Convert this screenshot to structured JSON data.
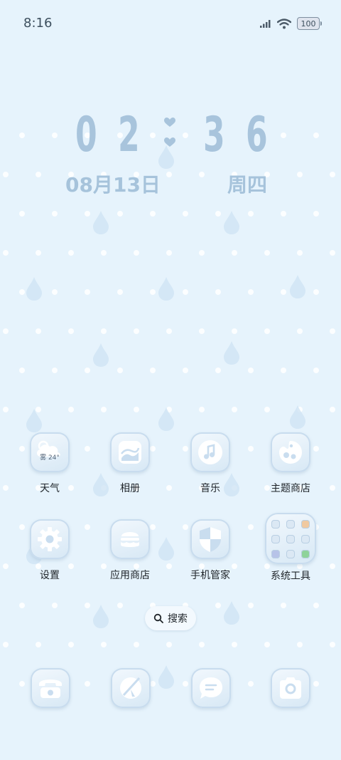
{
  "status_bar": {
    "time": "8:16",
    "battery": "100"
  },
  "clock": {
    "h1": "0",
    "h2": "2",
    "m1": "3",
    "m2": "6",
    "date": "08月13日",
    "weekday": "周四"
  },
  "apps_row1": [
    {
      "label": "天气",
      "weather_badge": "雾 24°"
    },
    {
      "label": "相册"
    },
    {
      "label": "音乐"
    },
    {
      "label": "主题商店"
    }
  ],
  "apps_row2": [
    {
      "label": "设置"
    },
    {
      "label": "应用商店"
    },
    {
      "label": "手机管家"
    },
    {
      "label": "系统工具"
    }
  ],
  "search": {
    "label": "搜索"
  },
  "colors": {
    "background": "#e6f3fc",
    "accent": "#a8c4dc",
    "icon_fg": "#ffffff"
  }
}
